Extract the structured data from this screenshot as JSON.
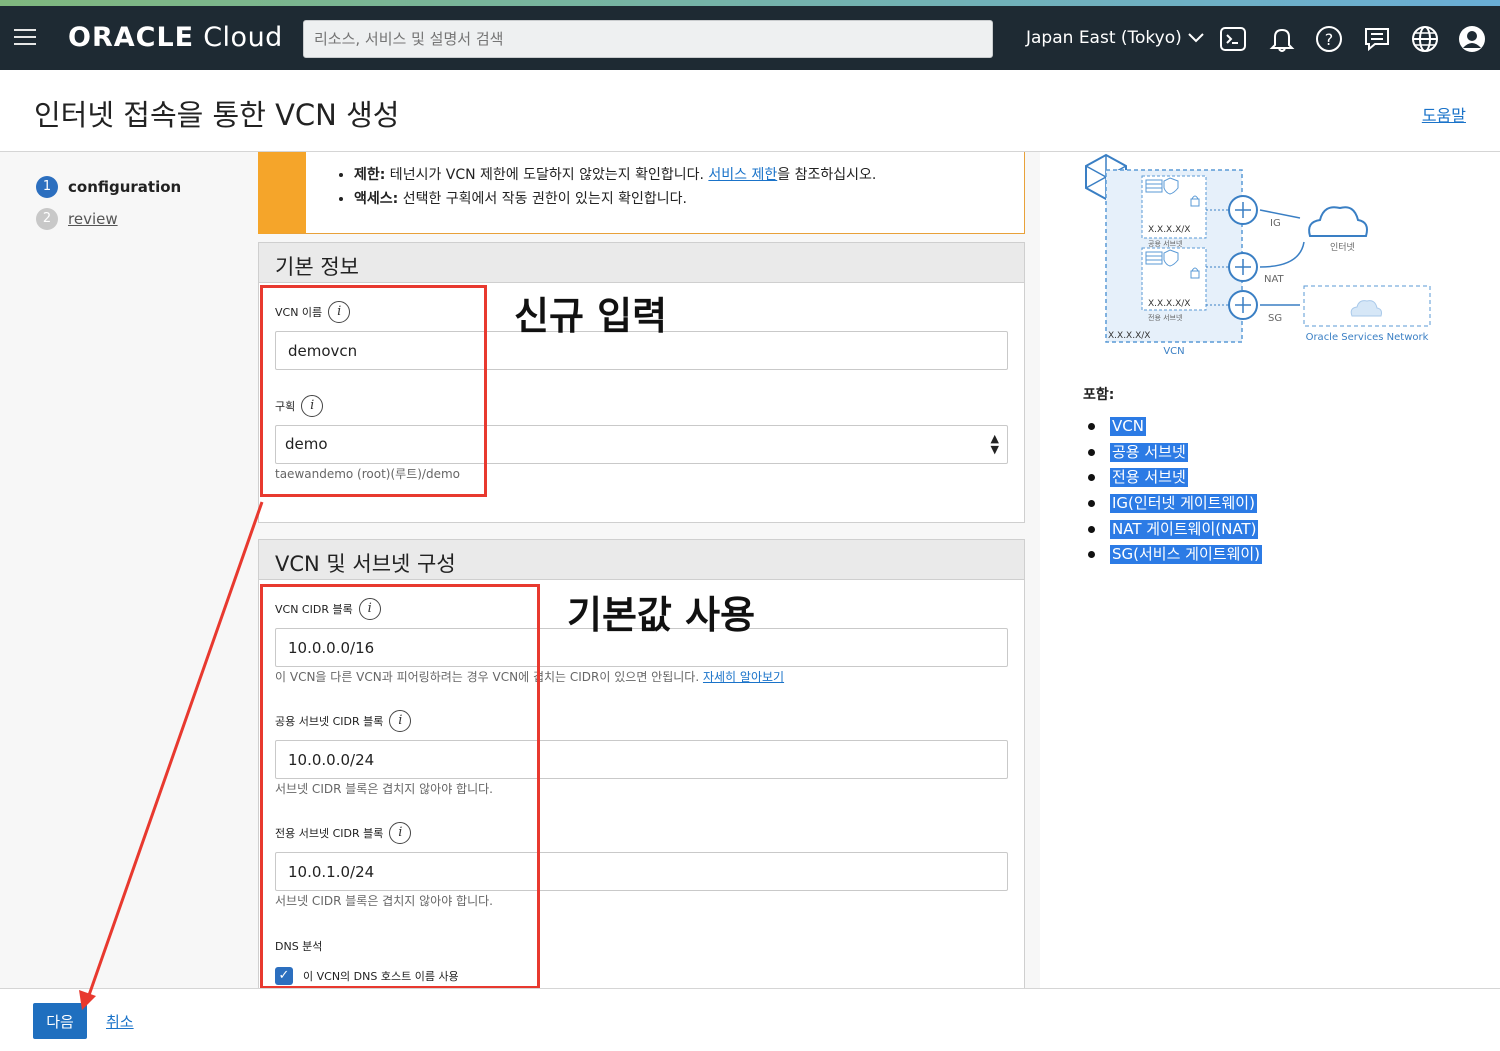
{
  "topbar": {
    "logo_bold": "ORACLE",
    "logo_cloud": " Cloud",
    "search_placeholder": "리소스, 서비스 및 설명서 검색",
    "region": "Japan East (Tokyo)"
  },
  "page": {
    "title": "인터넷 접속을 통한 VCN 생성",
    "help": "도움말"
  },
  "steps": [
    {
      "num": "1",
      "label": "configuration"
    },
    {
      "num": "2",
      "label": "review"
    }
  ],
  "warning": {
    "line1_bold": "제한:",
    "line1_text": " 테넌시가 VCN 제한에 도달하지 않았는지 확인합니다. ",
    "line1_link": "서비스 제한",
    "line1_tail": "을 참조하십시오.",
    "line2_bold": "액세스:",
    "line2_text": " 선택한 구획에서 작동 권한이 있는지 확인합니다."
  },
  "basic": {
    "heading": "기본 정보",
    "vcn_name_label": "VCN 이름",
    "vcn_name_value": "demovcn",
    "compartment_label": "구획",
    "compartment_value": "demo",
    "compartment_path": "taewandemo (root)(루트)/demo"
  },
  "network": {
    "heading": "VCN 및 서브넷 구성",
    "vcn_cidr_label": "VCN CIDR 블록",
    "vcn_cidr_value": "10.0.0.0/16",
    "vcn_cidr_hint": "이 VCN을 다른 VCN과 피어링하려는 경우 VCN에 겹치는 CIDR이 있으면 안됩니다. ",
    "vcn_cidr_hint_link": "자세히 알아보기",
    "public_label": "공용 서브넷 CIDR 블록",
    "public_value": "10.0.0.0/24",
    "public_hint": "서브넷 CIDR 블록은 겹치지 않아야 합니다.",
    "private_label": "전용 서브넷 CIDR 블록",
    "private_value": "10.0.1.0/24",
    "private_hint": "서브넷 CIDR 블록은 겹치지 않아야 합니다.",
    "dns_label": "DNS 분석",
    "dns_checkbox_label": "이 VCN의 DNS 호스트 이름 사용"
  },
  "annotations": {
    "new_input": "신규 입력",
    "use_default": "기본값 사용"
  },
  "diagram": {
    "ip1": "X.X.X.X/X",
    "public_subnet": "공용 서브넷",
    "ip2": "X.X.X.X/X",
    "private_subnet": "전용 서브넷",
    "ip3": "X.X.X.X/X",
    "vcn": "VCN",
    "ig": "IG",
    "nat": "NAT",
    "sg": "SG",
    "internet": "인터넷",
    "osn": "Oracle Services Network"
  },
  "contains": {
    "heading": "포함:",
    "items": [
      "VCN",
      "공용 서브넷",
      "전용 서브넷",
      "IG(인터넷 게이트웨이)",
      "NAT 게이트웨이(NAT)",
      "SG(서비스 게이트웨이)"
    ]
  },
  "footer": {
    "next": "다음",
    "cancel": "취소"
  },
  "colors": {
    "topbar": "#1e2a33",
    "primary": "#1f6fbf",
    "warning": "#f5a52a",
    "annotation_red": "#e8392f",
    "highlight": "#2c7be5"
  }
}
